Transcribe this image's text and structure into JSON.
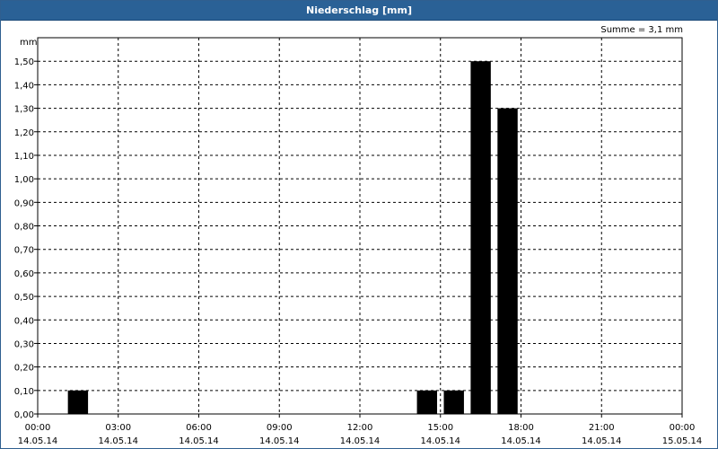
{
  "window": {
    "title": "Niederschlag [mm]"
  },
  "chart_data": {
    "type": "bar",
    "title": "Niederschlag [mm]",
    "ylabel": "mm",
    "annotation": "Summe = 3,1 mm",
    "ylim": [
      0,
      1.6
    ],
    "yticks": [
      "0,00",
      "0,10",
      "0,20",
      "0,30",
      "0,40",
      "0,50",
      "0,60",
      "0,70",
      "0,80",
      "0,90",
      "1,00",
      "1,10",
      "1,20",
      "1,30",
      "1,40",
      "1,50"
    ],
    "xticks": [
      {
        "time": "00:00",
        "date": "14.05.14"
      },
      {
        "time": "03:00",
        "date": "14.05.14"
      },
      {
        "time": "06:00",
        "date": "14.05.14"
      },
      {
        "time": "09:00",
        "date": "14.05.14"
      },
      {
        "time": "12:00",
        "date": "14.05.14"
      },
      {
        "time": "15:00",
        "date": "14.05.14"
      },
      {
        "time": "18:00",
        "date": "14.05.14"
      },
      {
        "time": "21:00",
        "date": "14.05.14"
      },
      {
        "time": "00:00",
        "date": "15.05.14"
      }
    ],
    "x_range_hours": [
      0,
      24
    ],
    "bar_width_hours": 0.75,
    "bars": [
      {
        "hour_center": 1.5,
        "value": 0.1
      },
      {
        "hour_center": 14.5,
        "value": 0.1
      },
      {
        "hour_center": 15.5,
        "value": 0.1
      },
      {
        "hour_center": 16.5,
        "value": 1.5
      },
      {
        "hour_center": 17.5,
        "value": 1.3
      }
    ],
    "grid": true,
    "bar_color": "#000000"
  }
}
